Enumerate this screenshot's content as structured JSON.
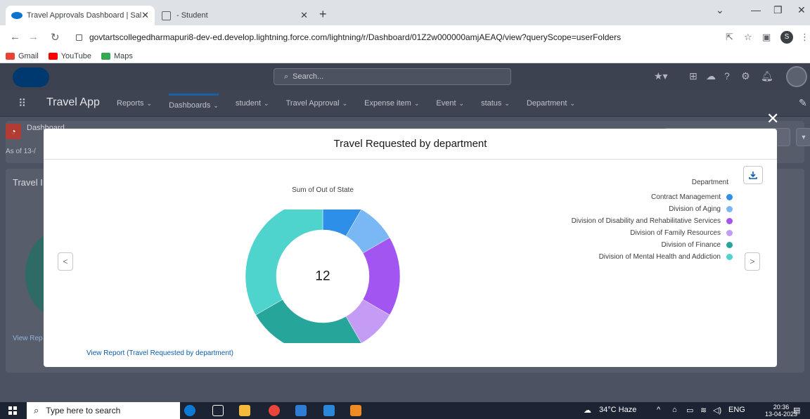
{
  "browser": {
    "tabs": [
      {
        "title": "Travel Approvals Dashboard | Sal",
        "active": true
      },
      {
        "title": "- Student",
        "active": false
      }
    ],
    "url": "govtartscollegedharmapuri8-dev-ed.develop.lightning.force.com/lightning/r/Dashboard/01Z2w000000amjAEAQ/view?queryScope=userFolders",
    "profile_initial": "S",
    "bookmarks": [
      {
        "label": "Gmail",
        "icon": "gmail-icon",
        "color": "#ea4335"
      },
      {
        "label": "YouTube",
        "icon": "youtube-icon",
        "color": "#ff0000"
      },
      {
        "label": "Maps",
        "icon": "maps-icon",
        "color": "#34a853"
      }
    ]
  },
  "sf": {
    "search_placeholder": "Search...",
    "app_name": "Travel App",
    "nav": [
      {
        "label": "Reports",
        "active": false
      },
      {
        "label": "Dashboards",
        "active": true
      },
      {
        "label": "student",
        "active": false
      },
      {
        "label": "Travel Approval",
        "active": false
      },
      {
        "label": "Expense item",
        "active": false
      },
      {
        "label": "Event",
        "active": false
      },
      {
        "label": "status",
        "active": false
      },
      {
        "label": "Department",
        "active": false
      }
    ],
    "dashboard_label": "Dashboard",
    "as_of": "As of 13-/",
    "panel_title": "Travel I",
    "panel_link": "View Rep"
  },
  "modal": {
    "title": "Travel Requested by department",
    "chart_subtitle": "Sum of Out of State",
    "center_value": "12",
    "legend_title": "Department",
    "view_report": "View Report (Travel Requested by department)"
  },
  "chart_data": {
    "type": "pie",
    "title": "Travel Requested by department",
    "subtitle": "Sum of Out of State",
    "total": 12,
    "legend_placement": "right",
    "series": [
      {
        "name": "Contract Management",
        "value": 1,
        "color": "#2e8fe8"
      },
      {
        "name": "Division of Aging",
        "value": 1,
        "color": "#7ab8f5"
      },
      {
        "name": "Division of Disability and Rehabilitative Services",
        "value": 2,
        "color": "#a355f2"
      },
      {
        "name": "Division of Family Resources",
        "value": 1,
        "color": "#c49cf5"
      },
      {
        "name": "Division of Finance",
        "value": 3,
        "color": "#26a69a"
      },
      {
        "name": "Division of Mental Health and Addiction",
        "value": 4,
        "color": "#4fd3cd"
      }
    ]
  },
  "taskbar": {
    "search_placeholder": "Type here to search",
    "weather": "34°C  Haze",
    "language": "ENG",
    "time": "20:36",
    "date": "13-04-2023"
  }
}
